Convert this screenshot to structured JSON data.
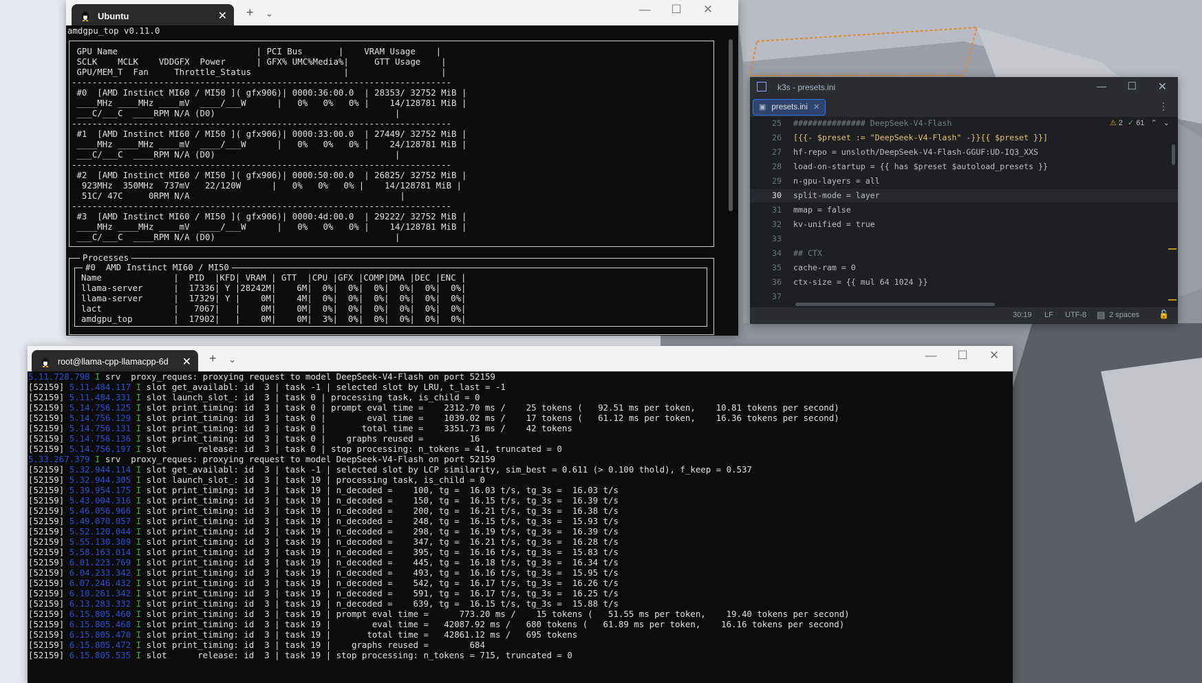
{
  "colors": {
    "terminal_bg": "#0c0c0c",
    "terminal_fg": "#e0e0e0",
    "timestamp_blue": "#2b4fd6",
    "level_green": "#36b04a",
    "ide_bg": "#1e1f22",
    "ide_accent": "#3574f0"
  },
  "top_terminal": {
    "tab_title": "Ubuntu",
    "tab_icon": "tux-icon",
    "header": "amdgpu_top v0.11.0",
    "gpu_table": [
      " GPU Name                           | PCI Bus       |    VRAM Usage    |",
      " SCLK    MCLK    VDDGFX  Power      | GFX% UMC%Media%|     GTT Usage    |",
      " GPU/MEM_T  Fan     Throttle_Status                  |                  |",
      "--------------------------------------------------------------------------",
      " #0  [AMD Instinct MI60 / MI50 ]( gfx906)| 0000:36:00.0  | 28353/ 32752 MiB |",
      " ____MHz ____MHz ____mV  ____/___W      |   0%   0%   0% |    14/128781 MiB |",
      " ___C/___C  ____RPM N/A (D0)                                   |",
      "--------------------------------------------------------------------------",
      " #1  [AMD Instinct MI60 / MI50 ]( gfx906)| 0000:33:00.0  | 27449/ 32752 MiB |",
      " ____MHz ____MHz ____mV  ____/___W      |   0%   0%   0% |    24/128781 MiB |",
      " ___C/___C  ____RPM N/A (D0)                                   |",
      "--------------------------------------------------------------------------",
      " #2  [AMD Instinct MI60 / MI50 ]( gfx906)| 0000:50:00.0  | 26825/ 32752 MiB |",
      "  923MHz  350MHz  737mV   22/120W      |   0%   0%   0% |    14/128781 MiB |",
      "  51C/ 47C     0RPM N/A                                         |",
      "--------------------------------------------------------------------------",
      " #3  [AMD Instinct MI60 / MI50 ]( gfx906)| 0000:4d:00.0  | 29222/ 32752 MiB |",
      " ____MHz ____MHz ____mV  ____/___W      |   0%   0%   0% |    14/128781 MiB |",
      " ___C/___C  ____RPM N/A (D0)                                   |"
    ],
    "processes_title": "Processes",
    "processes_gpu": "#0  AMD Instinct MI60 / MI50",
    "processes_header": "Name              |  PID  |KFD| VRAM | GTT  |CPU |GFX |COMP|DMA |DEC |ENC |",
    "processes": [
      "llama-server      |  17336| Y |28242M|    6M|  0%|  0%|  0%|  0%|  0%|  0%|",
      "llama-server      |  17329| Y |    0M|    4M|  0%|  0%|  0%|  0%|  0%|  0%|",
      "lact              |   7067|   |    0M|    0M|  0%|  0%|  0%|  0%|  0%|  0%|",
      "amdgpu_top        |  17902|   |    0M|    0M|  3%|  0%|  0%|  0%|  0%|  0%|"
    ]
  },
  "ide": {
    "window_title": "k3s - presets.ini",
    "tab_label": "presets.ini",
    "warnings": "2",
    "checks": "61",
    "lines": [
      {
        "n": "25",
        "t": "############### DeepSeek-V4-Flash"
      },
      {
        "n": "26",
        "t": "[{{- $preset := \"DeepSeek-V4-Flash\" -}}{{ $preset }}]"
      },
      {
        "n": "27",
        "t": "hf-repo = unsloth/DeepSeek-V4-Flash-GGUF:UD-IQ3_XXS"
      },
      {
        "n": "28",
        "t": "load-on-startup = {{ has $preset $autoload_presets }}"
      },
      {
        "n": "29",
        "t": "n-gpu-layers = all"
      },
      {
        "n": "30",
        "t": "split-mode = layer"
      },
      {
        "n": "31",
        "t": "mmap = false"
      },
      {
        "n": "32",
        "t": "kv-unified = true"
      },
      {
        "n": "33",
        "t": ""
      },
      {
        "n": "34",
        "t": "## CTX"
      },
      {
        "n": "35",
        "t": "cache-ram = 0"
      },
      {
        "n": "36",
        "t": "ctx-size = {{ mul 64 1024 }}"
      },
      {
        "n": "37",
        "t": ""
      }
    ],
    "status": {
      "position": "30:19",
      "line_ending": "LF",
      "encoding": "UTF-8",
      "indent": "2 spaces"
    }
  },
  "bottom_terminal": {
    "tab_title": "root@llama-cpp-llamacpp-6d",
    "tab_icon": "tux-icon",
    "log": [
      {
        "pre": "",
        "ts": "5.11.728.798",
        "lvl": "I",
        "msg": " srv  proxy_reques: proxying request to model DeepSeek-V4-Flash on port 52159"
      },
      {
        "pre": "[52159] ",
        "ts": "5.11.484.117",
        "lvl": "I",
        "msg": " slot get_availabl: id  3 | task -1 | selected slot by LRU, t_last = -1"
      },
      {
        "pre": "[52159] ",
        "ts": "5.11.484.331",
        "lvl": "I",
        "msg": " slot launch_slot_: id  3 | task 0 | processing task, is_child = 0"
      },
      {
        "pre": "[52159] ",
        "ts": "5.14.756.125",
        "lvl": "I",
        "msg": " slot print_timing: id  3 | task 0 | prompt eval time =    2312.70 ms /    25 tokens (   92.51 ms per token,    10.81 tokens per second)"
      },
      {
        "pre": "[52159] ",
        "ts": "5.14.756.129",
        "lvl": "I",
        "msg": " slot print_timing: id  3 | task 0 |        eval time =    1039.02 ms /    17 tokens (   61.12 ms per token,    16.36 tokens per second)"
      },
      {
        "pre": "[52159] ",
        "ts": "5.14.756.131",
        "lvl": "I",
        "msg": " slot print_timing: id  3 | task 0 |       total time =    3351.73 ms /    42 tokens"
      },
      {
        "pre": "[52159] ",
        "ts": "5.14.756.136",
        "lvl": "I",
        "msg": " slot print_timing: id  3 | task 0 |    graphs reused =         16"
      },
      {
        "pre": "[52159] ",
        "ts": "5.14.756.197",
        "lvl": "I",
        "msg": " slot      release: id  3 | task 0 | stop processing: n_tokens = 41, truncated = 0"
      },
      {
        "pre": "",
        "ts": "5.33.267.379",
        "lvl": "I",
        "msg": " srv  proxy_reques: proxying request to model DeepSeek-V4-Flash on port 52159"
      },
      {
        "pre": "[52159] ",
        "ts": "5.32.944.114",
        "lvl": "I",
        "msg": " slot get_availabl: id  3 | task -1 | selected slot by LCP similarity, sim_best = 0.611 (> 0.100 thold), f_keep = 0.537"
      },
      {
        "pre": "[52159] ",
        "ts": "5.32.944.305",
        "lvl": "I",
        "msg": " slot launch_slot_: id  3 | task 19 | processing task, is_child = 0"
      },
      {
        "pre": "[52159] ",
        "ts": "5.39.954.175",
        "lvl": "I",
        "msg": " slot print_timing: id  3 | task 19 | n_decoded =    100, tg =  16.03 t/s, tg_3s =  16.03 t/s"
      },
      {
        "pre": "[52159] ",
        "ts": "5.43.004.316",
        "lvl": "I",
        "msg": " slot print_timing: id  3 | task 19 | n_decoded =    150, tg =  16.15 t/s, tg_3s =  16.39 t/s"
      },
      {
        "pre": "[52159] ",
        "ts": "5.46.056.966",
        "lvl": "I",
        "msg": " slot print_timing: id  3 | task 19 | n_decoded =    200, tg =  16.21 t/s, tg_3s =  16.38 t/s"
      },
      {
        "pre": "[52159] ",
        "ts": "5.49.070.057",
        "lvl": "I",
        "msg": " slot print_timing: id  3 | task 19 | n_decoded =    248, tg =  16.15 t/s, tg_3s =  15.93 t/s"
      },
      {
        "pre": "[52159] ",
        "ts": "5.52.120.044",
        "lvl": "I",
        "msg": " slot print_timing: id  3 | task 19 | n_decoded =    298, tg =  16.19 t/s, tg_3s =  16.39 t/s"
      },
      {
        "pre": "[52159] ",
        "ts": "5.55.130.309",
        "lvl": "I",
        "msg": " slot print_timing: id  3 | task 19 | n_decoded =    347, tg =  16.21 t/s, tg_3s =  16.28 t/s"
      },
      {
        "pre": "[52159] ",
        "ts": "5.58.163.014",
        "lvl": "I",
        "msg": " slot print_timing: id  3 | task 19 | n_decoded =    395, tg =  16.16 t/s, tg_3s =  15.83 t/s"
      },
      {
        "pre": "[52159] ",
        "ts": "6.01.223.769",
        "lvl": "I",
        "msg": " slot print_timing: id  3 | task 19 | n_decoded =    445, tg =  16.18 t/s, tg_3s =  16.34 t/s"
      },
      {
        "pre": "[52159] ",
        "ts": "6.04.233.342",
        "lvl": "I",
        "msg": " slot print_timing: id  3 | task 19 | n_decoded =    493, tg =  16.16 t/s, tg_3s =  15.95 t/s"
      },
      {
        "pre": "[52159] ",
        "ts": "6.07.246.432",
        "lvl": "I",
        "msg": " slot print_timing: id  3 | task 19 | n_decoded =    542, tg =  16.17 t/s, tg_3s =  16.26 t/s"
      },
      {
        "pre": "[52159] ",
        "ts": "6.10.261.342",
        "lvl": "I",
        "msg": " slot print_timing: id  3 | task 19 | n_decoded =    591, tg =  16.17 t/s, tg_3s =  16.25 t/s"
      },
      {
        "pre": "[52159] ",
        "ts": "6.13.283.332",
        "lvl": "I",
        "msg": " slot print_timing: id  3 | task 19 | n_decoded =    639, tg =  16.15 t/s, tg_3s =  15.88 t/s"
      },
      {
        "pre": "[52159] ",
        "ts": "6.15.805.460",
        "lvl": "I",
        "msg": " slot print_timing: id  3 | task 19 | prompt eval time =      773.20 ms /    15 tokens (   51.55 ms per token,    19.40 tokens per second)"
      },
      {
        "pre": "[52159] ",
        "ts": "6.15.805.468",
        "lvl": "I",
        "msg": " slot print_timing: id  3 | task 19 |        eval time =   42087.92 ms /   680 tokens (   61.89 ms per token,    16.16 tokens per second)"
      },
      {
        "pre": "[52159] ",
        "ts": "6.15.805.470",
        "lvl": "I",
        "msg": " slot print_timing: id  3 | task 19 |       total time =   42861.12 ms /   695 tokens"
      },
      {
        "pre": "[52159] ",
        "ts": "6.15.805.472",
        "lvl": "I",
        "msg": " slot print_timing: id  3 | task 19 |    graphs reused =        684"
      },
      {
        "pre": "[52159] ",
        "ts": "6.15.805.535",
        "lvl": "I",
        "msg": " slot      release: id  3 | task 19 | stop processing: n_tokens = 715, truncated = 0"
      }
    ]
  }
}
